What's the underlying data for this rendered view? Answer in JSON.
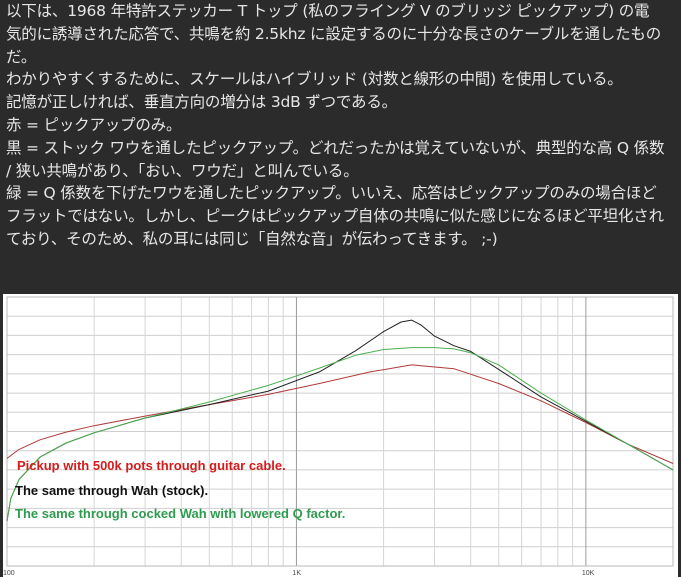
{
  "post": {
    "lines": [
      "以下は、1968 年特許ステッカー T トップ (私のフライング V のブリッジ ピックアップ) の電",
      "気的に誘導された応答で、共鳴を約 2.5khz に設定するのに十分な長さのケーブルを通したもの",
      "だ。",
      "わかりやすくするために、スケールはハイブリッド (対数と線形の中間) を使用している。",
      "記憶が正しければ、垂直方向の増分は 3dB ずつである。",
      "赤 = ピックアップのみ。",
      "黒 = ストック ワウを通したピックアップ。どれだったかは覚えていないが、典型的な高 Q 係数",
      "/ 狭い共鳴があり、「おい、ワウだ」と叫んでいる。",
      "緑 = Q 係数を下げたワウを通したピックアップ。いいえ、応答はピックアップのみの場合ほど",
      "フラットではない。しかし、ピークはピックアップ自体の共鳴に似た感じになるほど平坦化され",
      "ており、そのため、私の耳には同じ「自然な音」が伝わってきます。 ;-)"
    ]
  },
  "chart_data": {
    "type": "line",
    "x_scale": "log",
    "x_unit": "Hz",
    "xlim": [
      100,
      20000
    ],
    "x_tick_labels": [
      "100",
      "1K",
      "10K"
    ],
    "y_unit": "dB",
    "y_step_db": 3,
    "grid": true,
    "legend": [
      {
        "text": "Pickup with 500k pots through guitar cable.",
        "color": "#d41c1c"
      },
      {
        "text": "The same through Wah (stock).",
        "color": "#111111"
      },
      {
        "text": "The same through cocked Wah with lowered Q factor.",
        "color": "#2e9b4e"
      }
    ],
    "series": [
      {
        "name": "Pickup with 500k pots through guitar cable.",
        "color": "#b03a3a",
        "x": [
          100,
          110,
          130,
          160,
          200,
          300,
          500,
          800,
          1200,
          1800,
          2500,
          3500,
          5000,
          7000,
          10000,
          14000,
          20000
        ],
        "y": [
          -13.2,
          -11.8,
          -10.3,
          -9.1,
          -8.1,
          -6.6,
          -4.8,
          -3.2,
          -1.5,
          0.3,
          1.4,
          0.8,
          -1.5,
          -4.2,
          -7.6,
          -11.0,
          -14.0
        ]
      },
      {
        "name": "The same through Wah (stock).",
        "color": "#222222",
        "x": [
          100,
          103,
          110,
          130,
          160,
          200,
          300,
          500,
          800,
          1200,
          1600,
          2000,
          2300,
          2500,
          2700,
          3000,
          3500,
          4000,
          5000,
          7000,
          10000,
          14000,
          20000
        ],
        "y": [
          -23.0,
          -19.5,
          -16.5,
          -13.0,
          -10.8,
          -9.2,
          -6.9,
          -4.8,
          -2.7,
          0.3,
          3.6,
          6.6,
          8.1,
          8.4,
          7.6,
          5.9,
          4.4,
          3.5,
          0.7,
          -3.6,
          -7.4,
          -11.0,
          -15.0
        ]
      },
      {
        "name": "The same through cocked Wah with lowered Q factor.",
        "color": "#4caf50",
        "x": [
          100,
          103,
          110,
          130,
          160,
          200,
          300,
          500,
          800,
          1200,
          1600,
          2000,
          2500,
          3000,
          3500,
          4000,
          5000,
          7000,
          10000,
          14000,
          20000
        ],
        "y": [
          -23.0,
          -19.5,
          -16.5,
          -13.0,
          -10.8,
          -9.2,
          -6.9,
          -4.4,
          -1.8,
          0.9,
          2.9,
          3.8,
          4.1,
          4.1,
          3.9,
          3.3,
          1.4,
          -3.0,
          -7.2,
          -11.0,
          -15.0
        ]
      }
    ]
  }
}
